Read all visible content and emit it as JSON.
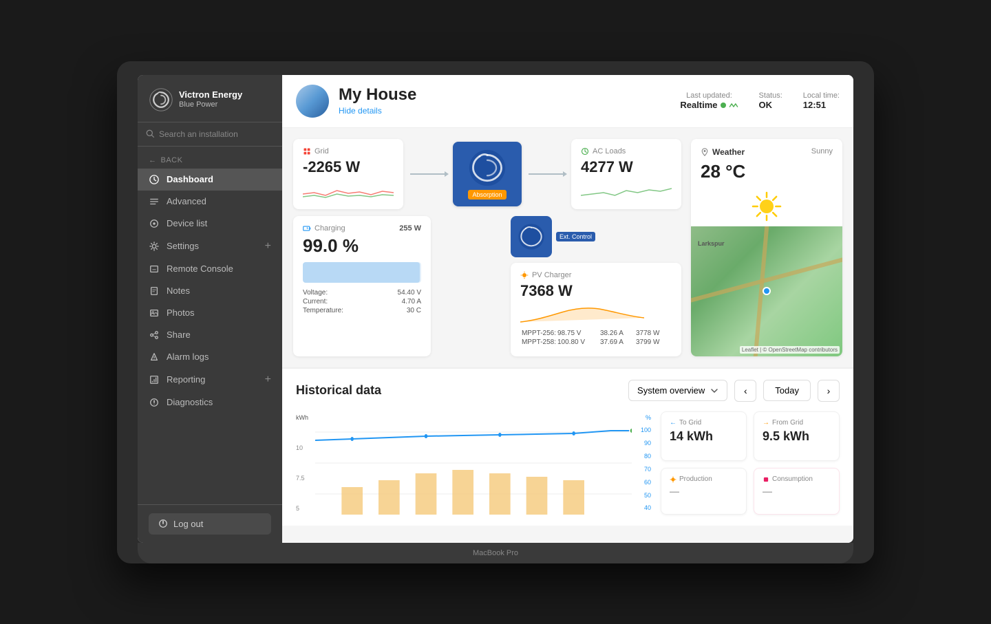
{
  "app": {
    "name": "Victron Energy",
    "subtitle": "Blue Power",
    "device_name": "MacBook Pro"
  },
  "sidebar": {
    "search_placeholder": "Search an installation",
    "back_label": "BACK",
    "nav_items": [
      {
        "id": "dashboard",
        "label": "Dashboard",
        "active": true
      },
      {
        "id": "advanced",
        "label": "Advanced",
        "active": false
      },
      {
        "id": "device-list",
        "label": "Device list",
        "active": false
      },
      {
        "id": "settings",
        "label": "Settings",
        "active": false,
        "has_plus": true
      },
      {
        "id": "remote-console",
        "label": "Remote Console",
        "active": false
      },
      {
        "id": "notes",
        "label": "Notes",
        "active": false
      },
      {
        "id": "photos",
        "label": "Photos",
        "active": false
      },
      {
        "id": "share",
        "label": "Share",
        "active": false
      },
      {
        "id": "alarm-logs",
        "label": "Alarm logs",
        "active": false
      },
      {
        "id": "reporting",
        "label": "Reporting",
        "active": false,
        "has_plus": true
      },
      {
        "id": "diagnostics",
        "label": "Diagnostics",
        "active": false
      }
    ],
    "logout_label": "Log out"
  },
  "header": {
    "house_name": "My House",
    "hide_details": "Hide details",
    "last_updated_label": "Last updated:",
    "last_updated_value": "Realtime",
    "status_label": "Status:",
    "status_value": "OK",
    "local_time_label": "Local time:",
    "local_time_value": "12:51"
  },
  "grid_card": {
    "title": "Grid",
    "value": "-2265 W",
    "color": "#f44336"
  },
  "inverter": {
    "label": "Absorption"
  },
  "ac_loads_card": {
    "title": "AC Loads",
    "value": "4277 W"
  },
  "battery_card": {
    "title": "Charging",
    "watts": "255 W",
    "percent": "99.0 %",
    "bar_percent": 99,
    "voltage_label": "Voltage:",
    "voltage_value": "54.40 V",
    "current_label": "Current:",
    "current_value": "4.70 A",
    "temperature_label": "Temperature:",
    "temperature_value": "30 C"
  },
  "pv_charger_card": {
    "title": "PV Charger",
    "value": "7368 W",
    "ext_control": "Ext. Control",
    "mppt": [
      {
        "name": "MPPT-256:",
        "voltage": "98.75 V",
        "current": "38.26 A",
        "power": "3778 W"
      },
      {
        "name": "MPPT-258:",
        "voltage": "100.80 V",
        "current": "37.69 A",
        "power": "3799 W"
      }
    ]
  },
  "weather_card": {
    "title": "Weather",
    "status": "Sunny",
    "temperature": "28 °C",
    "map_label": "Leaflet | © OpenStreetMap contributors"
  },
  "historical": {
    "title": "Historical data",
    "dropdown_label": "System overview",
    "today_label": "Today",
    "y_labels": [
      "10",
      "7.5",
      "5"
    ],
    "y_right_labels": [
      "100",
      "90",
      "80",
      "70",
      "60",
      "50",
      "40"
    ],
    "y_axis_label": "kWh",
    "y_axis_right_label": "%"
  },
  "stats": {
    "to_grid_label": "To Grid",
    "to_grid_value": "14 kWh",
    "from_grid_label": "From Grid",
    "from_grid_value": "9.5 kWh",
    "production_label": "Production",
    "consumption_label": "Consumption"
  }
}
